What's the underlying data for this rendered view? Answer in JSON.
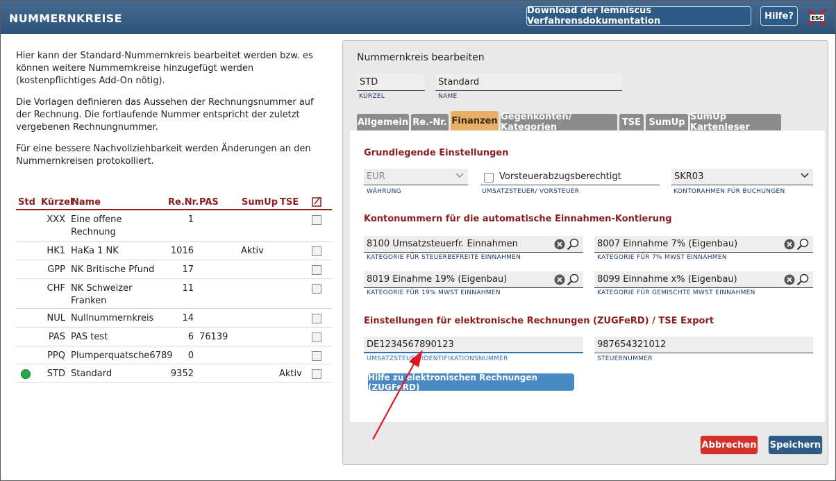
{
  "title": "NUMMERNKREISE",
  "header": {
    "download_label": "Download der lemniscus Verfahrensdokumentation",
    "help_label": "Hilfe?",
    "esc_label": "ESC"
  },
  "intro": {
    "p1": "Hier kann der Standard-Nummernkreis bearbeitet werden bzw. es können weitere Nummernkreise hinzugefügt werden (kostenpflichtiges Add-On nötig).",
    "p2": "Die Vorlagen definieren das Aussehen der Rechnungsnummer auf der Rechnung. Die fortlaufende Nummer entspricht der zuletzt vergebenen Rechnungnummer.",
    "p3": "Für eine bessere Nachvollziehbarkeit werden Änderungen an den Nummernkreisen protokolliert."
  },
  "table": {
    "headers": {
      "std": "Std",
      "kuerzel": "Kürzel",
      "name": "Name",
      "renr": "Re.Nr.",
      "pas": "PAS",
      "sumup": "SumUp",
      "tse": "TSE"
    },
    "rows": [
      {
        "kuerzel": "XXX",
        "name": "Eine offene",
        "name2": "Rechnung",
        "renr": "1",
        "pas": "",
        "sumup": "",
        "tse": "",
        "std": false
      },
      {
        "kuerzel": "HK1",
        "name": "HaKa 1 NK",
        "name2": "",
        "renr": "1016",
        "pas": "",
        "sumup": "Aktiv",
        "tse": "",
        "std": false
      },
      {
        "kuerzel": "GPP",
        "name": "NK Britische Pfund",
        "name2": "",
        "renr": "17",
        "pas": "",
        "sumup": "",
        "tse": "",
        "std": false
      },
      {
        "kuerzel": "CHF",
        "name": "NK Schweizer",
        "name2": "Franken",
        "renr": "11",
        "pas": "",
        "sumup": "",
        "tse": "",
        "std": false
      },
      {
        "kuerzel": "NUL",
        "name": "Nullnummernkreis",
        "name2": "",
        "renr": "14",
        "pas": "",
        "sumup": "",
        "tse": "",
        "std": false
      },
      {
        "kuerzel": "PAS",
        "name": "PAS test",
        "name2": "",
        "renr": "6",
        "pas": "76139",
        "sumup": "",
        "tse": "",
        "std": false
      },
      {
        "kuerzel": "PPQ",
        "name": "Plumperquatsche6789",
        "name2": "",
        "renr": "0",
        "pas": "",
        "sumup": "",
        "tse": "",
        "std": false
      },
      {
        "kuerzel": "STD",
        "name": "Standard",
        "name2": "",
        "renr": "9352",
        "pas": "",
        "sumup": "",
        "tse": "Aktiv",
        "std": true
      }
    ]
  },
  "editor": {
    "heading": "Nummernkreis bearbeiten",
    "kuerzel_value": "STD",
    "kuerzel_label": "KÜRZEL",
    "name_value": "Standard",
    "name_label": "NAME",
    "tabs": [
      "Allgemein",
      "Re.-Nr.",
      "Finanzen",
      "Gegenkonten/ Kategorien",
      "TSE",
      "SumUp",
      "SumUp Kartenleser"
    ],
    "active_tab": "Finanzen",
    "sections": {
      "basic": "Grundlegende Einstellungen",
      "accounts": "Kontonummern für die automatische Einnahmen-Kontierung",
      "einvoice": "Einstellungen für elektronische Rechnungen (ZUGFeRD) / TSE Export"
    },
    "currency_value": "EUR",
    "currency_label": "WÄHRUNG",
    "vat_checkbox_label": "Vorsteuerabzugsberechtigt",
    "vat_label": "UMSATZSTEUER/ VORSTEUER",
    "chart_value": "SKR03",
    "chart_label": "KONTORAHMEN FÜR BUCHUNGEN",
    "cat_free_value": "8100 Umsatzsteuerfr. Einnahmen",
    "cat_free_label": "KATEGORIE FÜR STEUERBEFREITE EINNAHMEN",
    "cat_7_value": "8007 Einnahme 7% (Eigenbau)",
    "cat_7_label": "KATEGORIE FÜR 7% MWST EINNAHMEN",
    "cat_19_value": "8019 Einahme 19% (Eigenbau)",
    "cat_19_label": "KATEGORIE FÜR 19% MWST EINNAHMEN",
    "cat_mixed_value": "8099 Einnahme x% (Eigenbau)",
    "cat_mixed_label": "KATEGORIE FÜR GEMISCHTE MWST EINNAHMEN",
    "ustid_value": "DE1234567890123",
    "ustid_label": "UMSATZSTEUER-IDENTIFIKATIONSNUMMER",
    "taxno_value": "987654321012",
    "taxno_label": "STEUERNUMMER",
    "help_einvoice": "Hilfe zu elektronischen Rechnungen (ZUGFeRD)"
  },
  "footer": {
    "cancel": "Abbrechen",
    "save": "Speichern"
  },
  "colors": {
    "accent_red": "#8b1e1e",
    "title_blue": "#2e5278",
    "active_tab": "#e7b068",
    "arrow": "#e0151f"
  }
}
